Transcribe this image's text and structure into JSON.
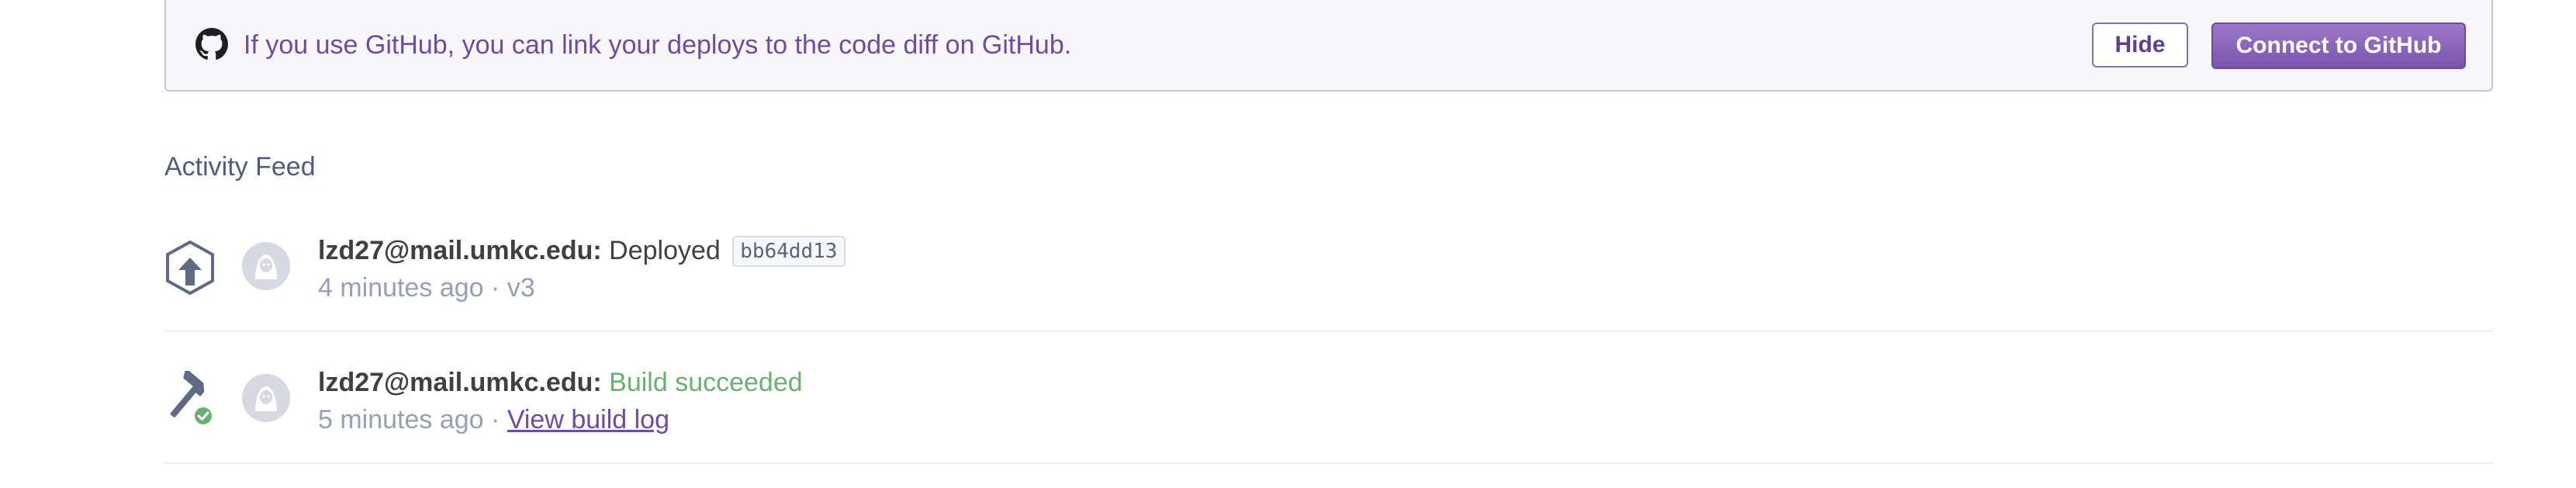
{
  "banner": {
    "icon": "github-icon",
    "text": "If you use GitHub, you can link your deploys to the code diff on GitHub.",
    "hide_label": "Hide",
    "connect_label": "Connect to GitHub"
  },
  "feed": {
    "title": "Activity Feed",
    "items": [
      {
        "icon": "deploy-upload-icon",
        "user": "lzd27@mail.umkc.edu:",
        "action": "Deployed",
        "commit": "bb64dd13",
        "time": "4 minutes ago",
        "separator": " · ",
        "version": "v3"
      },
      {
        "icon": "build-hammer-success-icon",
        "user": "lzd27@mail.umkc.edu:",
        "action": "Build succeeded",
        "time": "5 minutes ago",
        "separator": " · ",
        "link": "View build log"
      }
    ]
  },
  "colors": {
    "accent": "#79589f",
    "success": "#6ab06f",
    "muted": "#96a0b4"
  }
}
